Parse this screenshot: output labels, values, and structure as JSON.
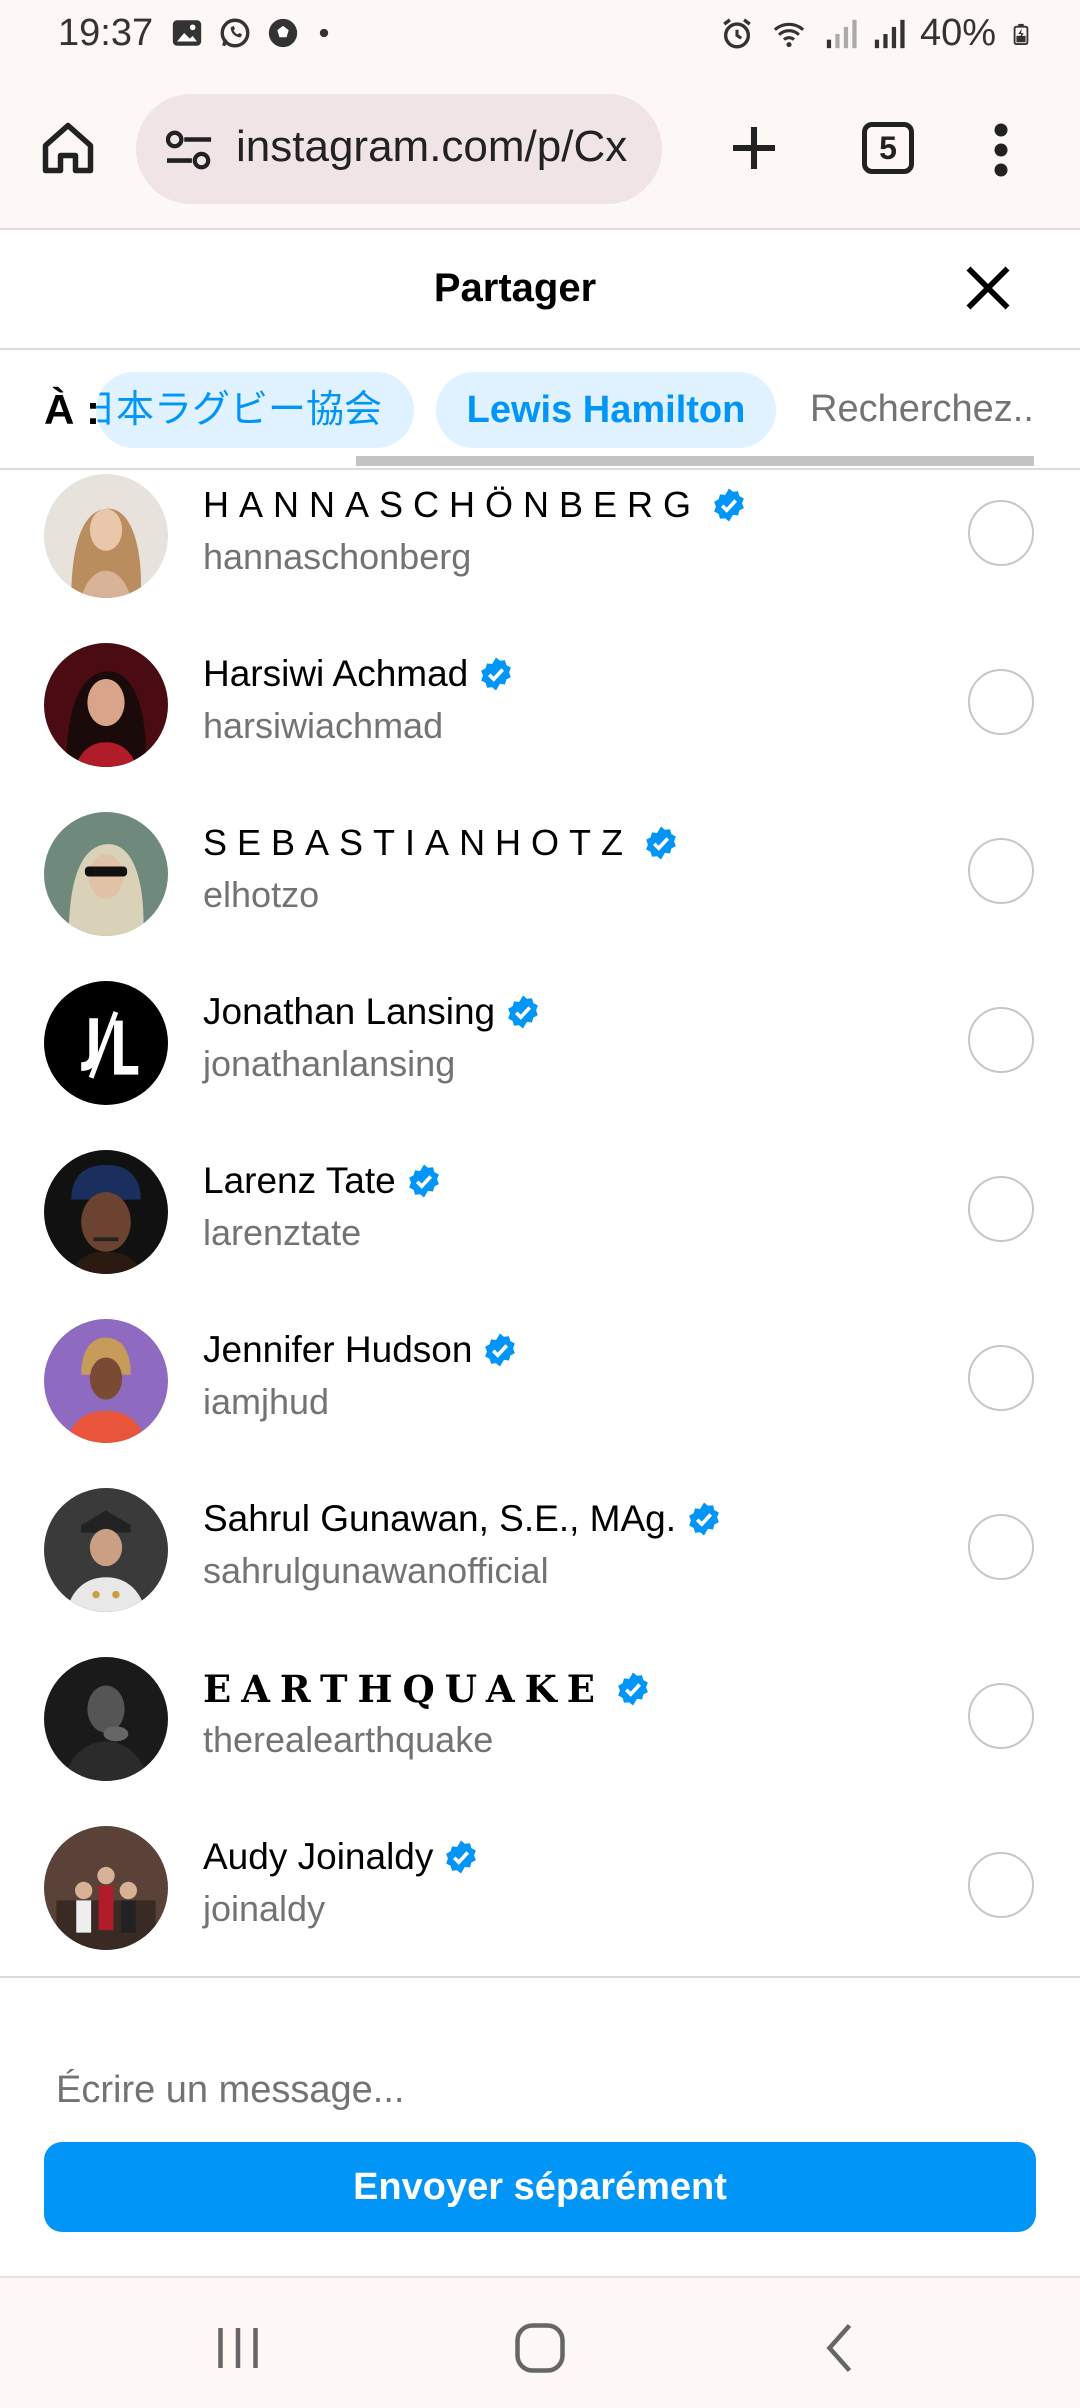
{
  "status_bar": {
    "time": "19:37",
    "left_icons": [
      "gallery-icon",
      "whatsapp-icon",
      "soccer-ball-icon",
      "dot-icon"
    ],
    "right_icons": [
      "alarm-icon",
      "wifi-icon",
      "signal-icon",
      "signal-icon"
    ],
    "battery": "40%"
  },
  "browser": {
    "url": "instagram.com/p/Cx",
    "tab_count": "5"
  },
  "share": {
    "title": "Partager",
    "to_label": "À :",
    "chips": [
      "日本ラグビー協会",
      "Lewis Hamilton"
    ],
    "search_placeholder": "Recherchez.."
  },
  "accounts": [
    {
      "name": "HANNASCHÖNBERG",
      "username": "hannaschonberg",
      "verified": true
    },
    {
      "name": "Harsiwi Achmad",
      "username": "harsiwiachmad",
      "verified": true
    },
    {
      "name": "SEBASTIANHOTZ",
      "username": "elhotzo",
      "verified": true
    },
    {
      "name": "Jonathan Lansing",
      "username": "jonathanlansing",
      "verified": true
    },
    {
      "name": "Larenz Tate",
      "username": "larenztate",
      "verified": true
    },
    {
      "name": "Jennifer Hudson",
      "username": "iamjhud",
      "verified": true
    },
    {
      "name": "Sahrul Gunawan, S.E., MAg.",
      "username": "sahrulgunawanofficial",
      "verified": true
    },
    {
      "name": "EARTHQUAKE",
      "username": "therealearthquake",
      "verified": true
    },
    {
      "name": "Audy Joinaldy",
      "username": "joinaldy",
      "verified": true
    }
  ],
  "compose": {
    "message_placeholder": "Écrire un message...",
    "send_label": "Envoyer séparément"
  },
  "colors": {
    "accent": "#0095f6",
    "chip_bg": "#e0f1ff",
    "secondary_text": "#737373"
  }
}
